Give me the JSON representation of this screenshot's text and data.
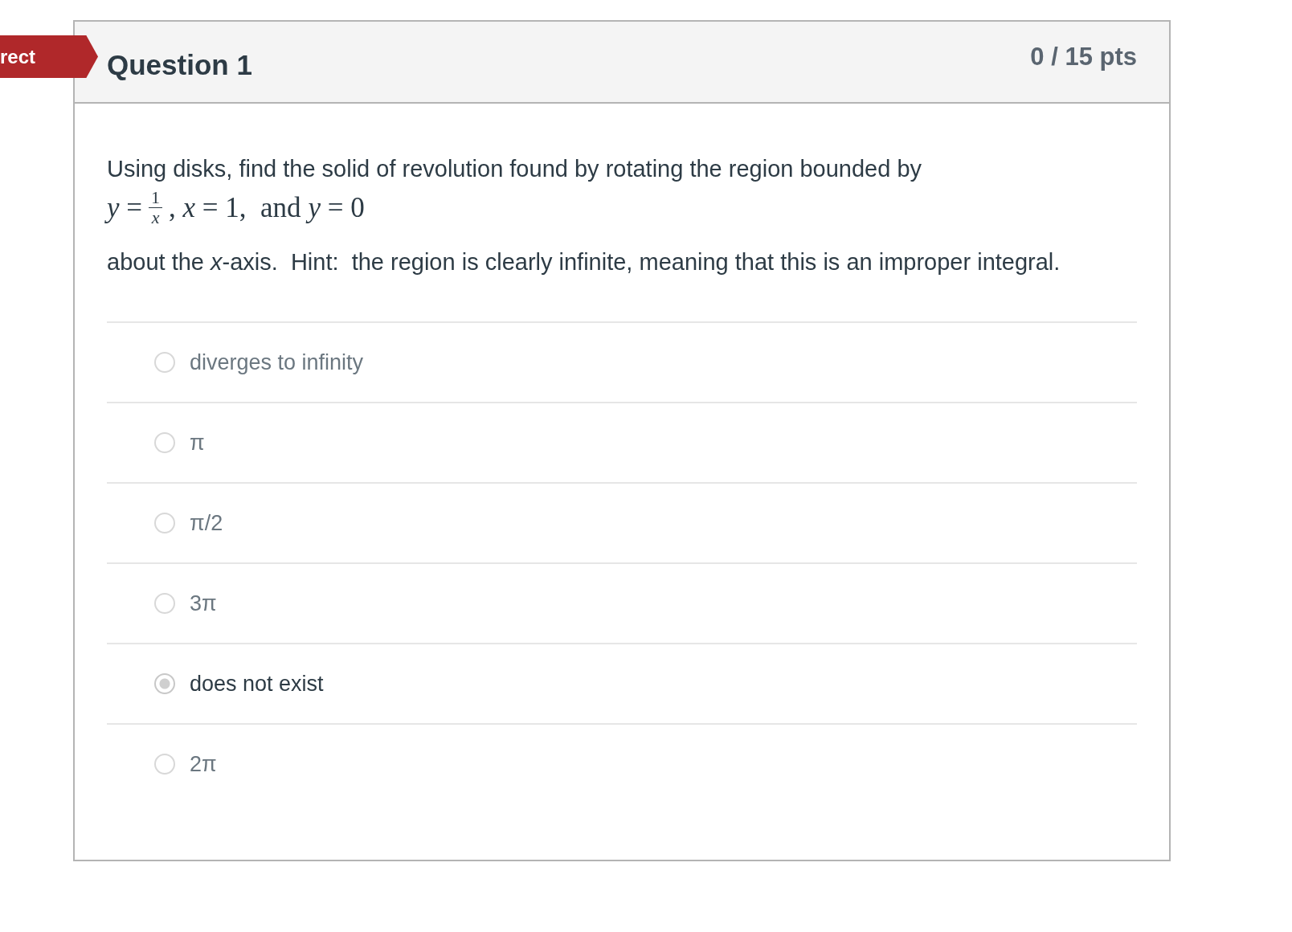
{
  "badge": {
    "label": "rect"
  },
  "question": {
    "title": "Question 1",
    "points": "0 / 15 pts"
  },
  "prompt": {
    "intro": "Using disks, find the solid of revolution found by rotating the region bounded by",
    "formula": {
      "lhs": "*y* =",
      "numerator": "1",
      "denominator": "*x*",
      "rest": ", *x* = 1,  and *y* = 0"
    },
    "hint": "about the *x*-axis.  Hint:  the region is clearly infinite, meaning that this is an improper integral."
  },
  "answers": [
    {
      "label": "diverges to infinity",
      "selected": false
    },
    {
      "label": "π",
      "selected": false
    },
    {
      "label": "π/2",
      "selected": false
    },
    {
      "label": "3π",
      "selected": false
    },
    {
      "label": "does not exist",
      "selected": true
    },
    {
      "label": "2π",
      "selected": false
    }
  ]
}
